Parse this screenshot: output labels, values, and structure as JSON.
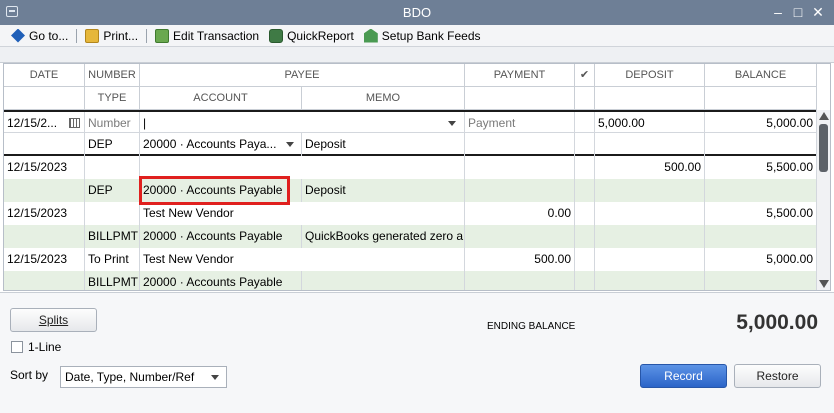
{
  "window": {
    "title": "BDO"
  },
  "toolbar": {
    "goto": "Go to...",
    "print": "Print...",
    "edit": "Edit Transaction",
    "quickreport": "QuickReport",
    "bankfeeds": "Setup Bank Feeds"
  },
  "columns": {
    "date": "DATE",
    "number": "NUMBER",
    "type": "TYPE",
    "payee": "PAYEE",
    "account": "ACCOUNT",
    "memo": "MEMO",
    "payment": "PAYMENT",
    "cleared": "✔",
    "deposit": "DEPOSIT",
    "balance": "BALANCE"
  },
  "entry_row": {
    "date": "12/15/2...",
    "number_placeholder": "Number",
    "payee": "",
    "payment_placeholder": "Payment",
    "deposit": "5,000.00",
    "balance": "5,000.00",
    "type": "DEP",
    "account": "20000 · Accounts Paya...",
    "memo": "Deposit"
  },
  "transactions": [
    {
      "date": "12/15/2023",
      "number": "",
      "payee": "",
      "payment": "",
      "deposit": "500.00",
      "balance": "5,500.00",
      "type": "DEP",
      "account": "20000 · Accounts Payable",
      "memo": "Deposit"
    },
    {
      "date": "12/15/2023",
      "number": "",
      "payee": "Test New Vendor",
      "payment": "0.00",
      "deposit": "",
      "balance": "5,500.00",
      "type": "BILLPMT",
      "account": "20000 · Accounts Payable",
      "memo": "QuickBooks generated zero a"
    },
    {
      "date": "12/15/2023",
      "number": "To Print",
      "payee": "Test New Vendor",
      "payment": "500.00",
      "deposit": "",
      "balance": "5,000.00",
      "type": "BILLPMT",
      "account": "20000 · Accounts Payable",
      "memo": ""
    }
  ],
  "footer": {
    "splits": "Splits",
    "one_line": "1-Line",
    "sort_by_label": "Sort by",
    "sort_by_value": "Date, Type, Number/Ref",
    "ending_balance_label": "ENDING BALANCE",
    "ending_balance_value": "5,000.00",
    "record": "Record",
    "restore": "Restore"
  },
  "colors": {
    "titlebar": "#6e7f96",
    "row_alt": "#e6f0e3",
    "highlight": "#e0201e",
    "primary": "#2b64c8"
  }
}
